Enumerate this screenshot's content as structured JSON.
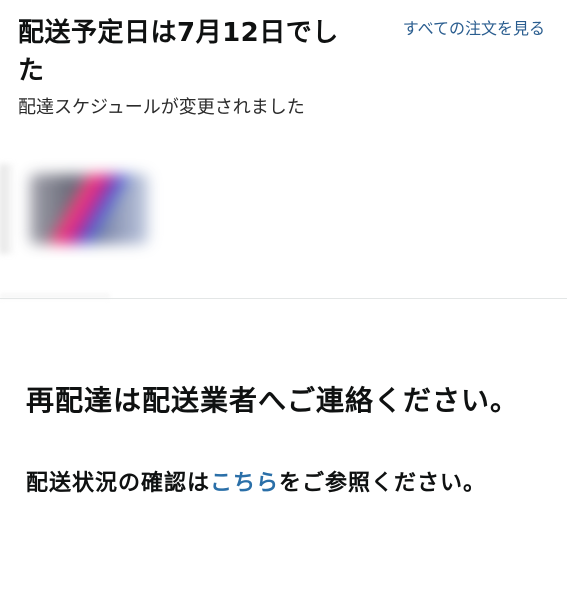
{
  "header": {
    "delivery_title": "配送予定日は7月12日でした",
    "view_all_orders": "すべての注文を見る",
    "schedule_changed": "配達スケジュールが変更されました"
  },
  "product": {
    "thumbnail_icon": "blurred-product-image"
  },
  "notice": {
    "redelivery": "再配達は配送業者へご連絡ください。",
    "status_prefix": "配送状況の確認は",
    "status_link": "こちら",
    "status_suffix": "をご参照ください。"
  },
  "colors": {
    "link": "#2a5d8f",
    "text": "#0f1111",
    "divider": "#e3e6e6"
  }
}
